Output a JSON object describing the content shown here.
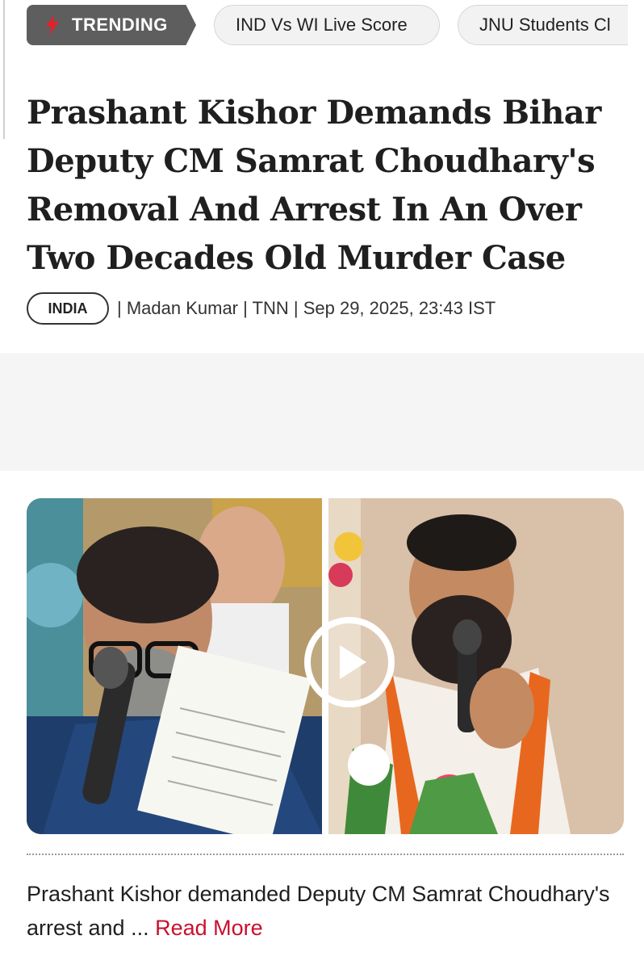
{
  "trending": {
    "label": "TRENDING",
    "items": [
      "IND Vs WI Live Score",
      "JNU Students Cl"
    ]
  },
  "article": {
    "headline": "Prashant Kishor Demands Bihar Deputy CM Samrat Choudhary's Removal And Arrest In An Over Two Decades Old Murder Case",
    "category": "INDIA",
    "byline": "| Madan Kumar | TNN | Sep 29, 2025, 23:43 IST",
    "summary": "Prashant Kishor demanded Deputy CM Samrat Choudhary's arrest and ...",
    "read_more": "Read More"
  },
  "icons": {
    "trending": "bolt-icon",
    "media": "play-icon"
  },
  "colors": {
    "accent": "#c8102e",
    "trending_tag": "#5e5e5e",
    "pill_bg": "#f2f2f2"
  }
}
